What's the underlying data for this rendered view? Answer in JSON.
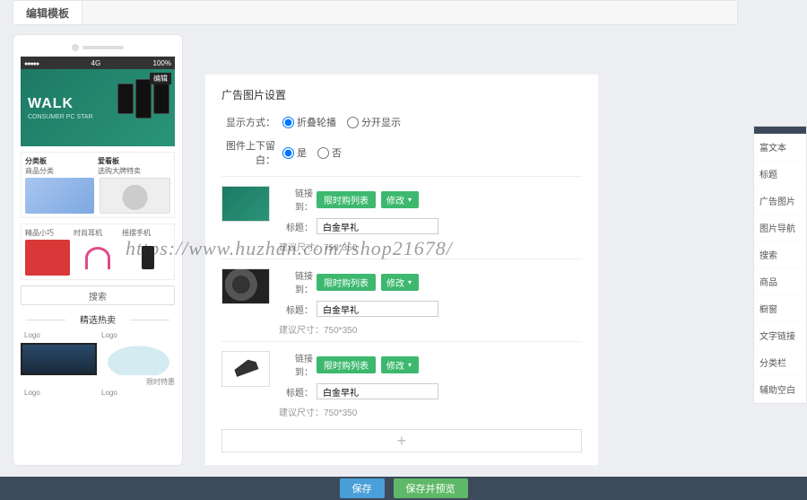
{
  "tab": {
    "label": "编辑模板"
  },
  "phone": {
    "status": {
      "carrier": "4G",
      "time": "",
      "battery": "100%"
    },
    "hero": {
      "title": "WALK",
      "subtitle": "CONSUMER PC STAR",
      "badge": "编辑"
    },
    "section1": {
      "col1_title": "分类板",
      "col1_sub": "商品分类",
      "col2_title": "爱看板",
      "col2_sub": "选购大牌特卖"
    },
    "section2": {
      "col1": "精品小巧",
      "col2": "时尚耳机",
      "col3": "摇摆手机"
    },
    "search_label": "搜索",
    "picks_title": "精选热卖",
    "logo1": "Logo",
    "logo2": "Logo",
    "logo3": "Logo",
    "logo4": "Logo",
    "pick2_label": "限时特惠"
  },
  "settings": {
    "title": "广告图片设置",
    "display_label": "显示方式：",
    "display_opt1": "折叠轮播",
    "display_opt2": "分开显示",
    "margin_label": "图件上下留白：",
    "margin_opt1": "是",
    "margin_opt2": "否",
    "link_label": "链接到：",
    "title_label": "标题：",
    "size_hint_label": "建议尺寸：",
    "size_hint_value": "750*350",
    "modify_label": "修改",
    "items": [
      {
        "link_target": "限时购列表",
        "title_value": "白金早礼"
      },
      {
        "link_target": "限时购列表",
        "title_value": "白金早礼"
      },
      {
        "link_target": "限时购列表",
        "title_value": "白金早礼"
      }
    ],
    "add_label": "+"
  },
  "toolbox": {
    "items": [
      "富文本",
      "标题",
      "广告图片",
      "图片导航",
      "搜索",
      "商品",
      "橱窗",
      "文字链接",
      "分类栏",
      "辅助空白"
    ]
  },
  "footer": {
    "save": "保存",
    "save_preview": "保存并预览"
  },
  "watermark": "https://www.huzhan.com/ishop21678/"
}
